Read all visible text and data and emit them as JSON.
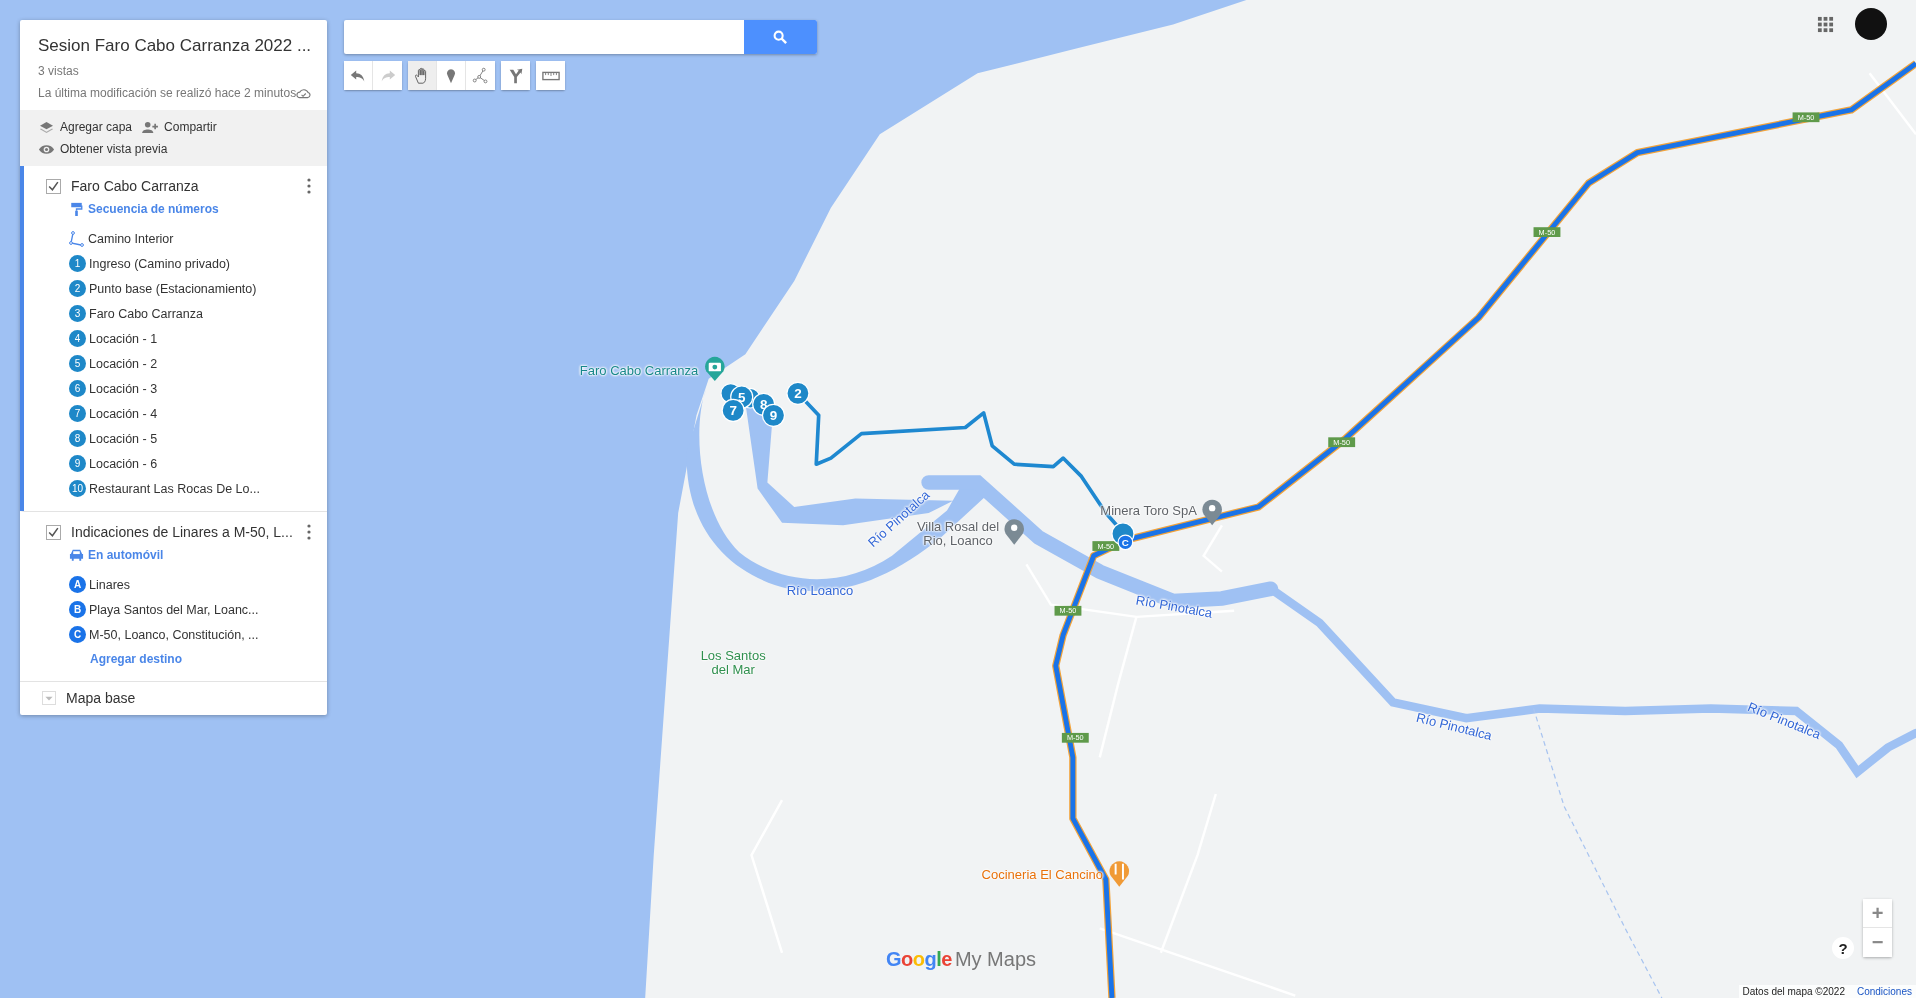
{
  "map_title": {
    "title": "Sesion Faro Cabo Carranza 2022 ...",
    "views": "3 vistas",
    "last_modified": "La última modificación se realizó hace 2 minutos",
    "saved": true
  },
  "actions": [
    {
      "kind": "add_layer",
      "label": "Agregar capa"
    },
    {
      "kind": "share",
      "label": "Compartir"
    },
    {
      "kind": "preview",
      "label": "Obtener vista previa"
    }
  ],
  "layers": [
    {
      "name": "Faro Cabo Carranza",
      "checked": true,
      "selected": true,
      "kind": "markers",
      "style_label": "Secuencia de números",
      "items": [
        {
          "kind": "line",
          "label": "Camino Interior"
        },
        {
          "kind": "number",
          "badge": "1",
          "label": "Ingreso (Camino privado)"
        },
        {
          "kind": "number",
          "badge": "2",
          "label": "Punto base (Estacionamiento)"
        },
        {
          "kind": "number",
          "badge": "3",
          "label": "Faro Cabo Carranza"
        },
        {
          "kind": "number",
          "badge": "4",
          "label": "Locación - 1"
        },
        {
          "kind": "number",
          "badge": "5",
          "label": "Locación - 2"
        },
        {
          "kind": "number",
          "badge": "6",
          "label": "Locación - 3"
        },
        {
          "kind": "number",
          "badge": "7",
          "label": "Locación - 4"
        },
        {
          "kind": "number",
          "badge": "8",
          "label": "Locación - 5"
        },
        {
          "kind": "number",
          "badge": "9",
          "label": "Locación - 6"
        },
        {
          "kind": "number",
          "badge": "10",
          "label": "Restaurant Las Rocas De Lo..."
        }
      ]
    },
    {
      "name": "Indicaciones de Linares a M-50, L...",
      "checked": true,
      "selected": false,
      "kind": "directions",
      "style_label": "En automóvil",
      "items": [
        {
          "kind": "letter",
          "badge": "A",
          "label": "Linares"
        },
        {
          "kind": "letter",
          "badge": "B",
          "label": "Playa Santos del Mar, Loanc..."
        },
        {
          "kind": "letter",
          "badge": "C",
          "label": "M-50, Loanco, Constitución, ..."
        }
      ],
      "add_label": "Agregar destino"
    }
  ],
  "base_map": {
    "label": "Mapa base",
    "expanded": false
  },
  "toolbar": [
    {
      "kind": "undo",
      "selected": false,
      "disabled": false
    },
    {
      "kind": "redo",
      "selected": false,
      "disabled": true
    },
    {
      "kind": "pan",
      "selected": true,
      "disabled": false
    },
    {
      "kind": "marker",
      "selected": false,
      "disabled": false
    },
    {
      "kind": "line",
      "selected": false,
      "disabled": false
    },
    {
      "kind": "directions",
      "selected": false,
      "disabled": false
    },
    {
      "kind": "ruler",
      "selected": false,
      "disabled": false
    }
  ],
  "map": {
    "labels": [
      {
        "kind": "landmark",
        "text": "Faro Cabo Carranza"
      },
      {
        "kind": "water",
        "text": "Río Pinotalca"
      },
      {
        "kind": "business",
        "text": "Villa Rosal del Rio, Loanco"
      },
      {
        "kind": "water",
        "text": "Río Loanco"
      },
      {
        "kind": "business",
        "text": "Minera Toro SpA"
      },
      {
        "kind": "water",
        "text": "Río Pinotalca"
      },
      {
        "kind": "place",
        "text": "Los Santos del Mar"
      },
      {
        "kind": "water",
        "text": "Río Pinotalca"
      },
      {
        "kind": "water",
        "text": "Río Pinotalca"
      },
      {
        "kind": "restaurant",
        "text": "Cocineria El Cancino"
      }
    ],
    "markers": [
      {
        "kind": "number",
        "text": "5"
      },
      {
        "kind": "number",
        "text": "7"
      },
      {
        "kind": "number",
        "text": "8"
      },
      {
        "kind": "number",
        "text": "9"
      },
      {
        "kind": "number",
        "text": "2"
      },
      {
        "kind": "letter",
        "text": "C"
      }
    ],
    "road_shields": [
      "M-50",
      "M-50",
      "M-50",
      "M-50",
      "M-50",
      "M-50"
    ]
  },
  "logo": {
    "brand": "Google",
    "product": "My Maps"
  },
  "controls": {
    "zoom_in": "+",
    "zoom_out": "−",
    "help": "?"
  },
  "attribution": {
    "data": "Datos del mapa ©2022",
    "terms": "Condiciones"
  }
}
